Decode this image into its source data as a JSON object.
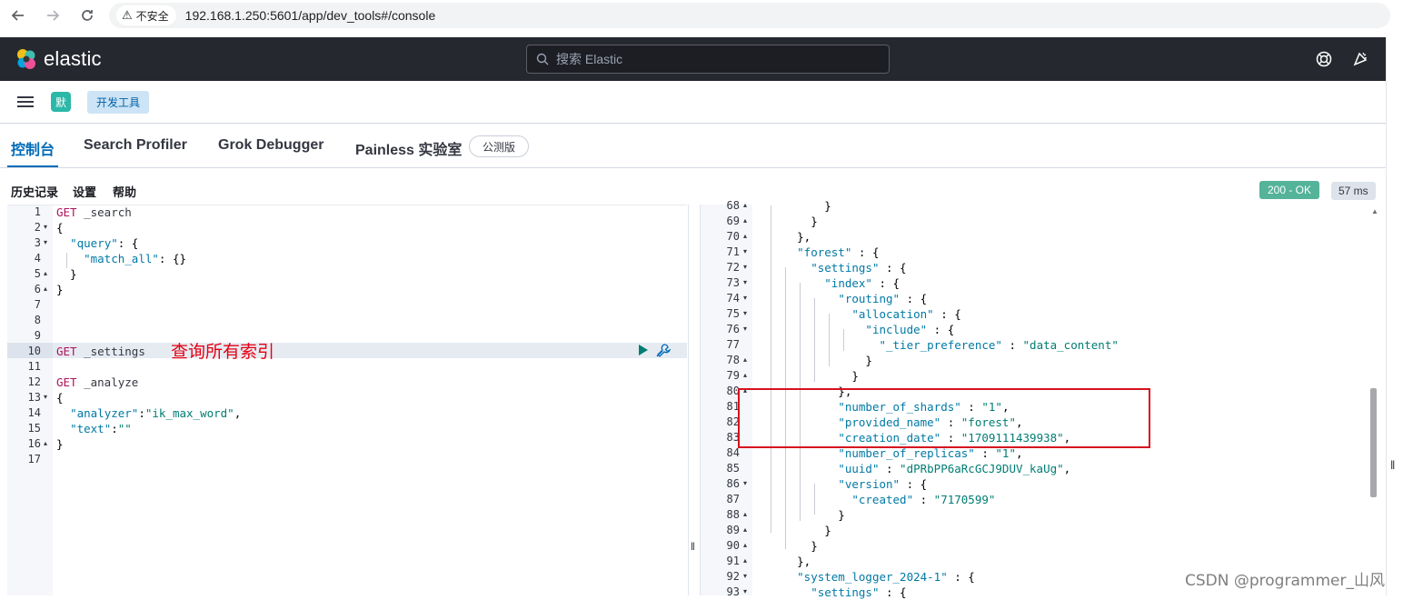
{
  "browser": {
    "insecure_label": "不安全",
    "url": "192.168.1.250:5601/app/dev_tools#/console"
  },
  "header": {
    "logo_text": "elastic",
    "search_placeholder": "搜索 Elastic"
  },
  "breadcrumbs": {
    "space_initial": "默",
    "current": "开发工具"
  },
  "tabs": {
    "console": "控制台",
    "search_profiler": "Search Profiler",
    "grok_debugger": "Grok Debugger",
    "painless_lab": "Painless 实验室",
    "beta_badge": "公测版"
  },
  "toolbar": {
    "history": "历史记录",
    "settings": "设置",
    "help": "帮助",
    "status": "200 - OK",
    "time": "57 ms"
  },
  "annotation": "查询所有索引",
  "request_lines": [
    {
      "n": "1",
      "fold": "",
      "text": "GET _search"
    },
    {
      "n": "2",
      "fold": "▾",
      "text": "{"
    },
    {
      "n": "3",
      "fold": "▾",
      "text": "  \"query\": {"
    },
    {
      "n": "4",
      "fold": "",
      "text": "    \"match_all\": {}"
    },
    {
      "n": "5",
      "fold": "▴",
      "text": "  }"
    },
    {
      "n": "6",
      "fold": "▴",
      "text": "}"
    },
    {
      "n": "7",
      "fold": "",
      "text": ""
    },
    {
      "n": "8",
      "fold": "",
      "text": ""
    },
    {
      "n": "9",
      "fold": "",
      "text": ""
    },
    {
      "n": "10",
      "fold": "",
      "text": "GET _settings"
    },
    {
      "n": "11",
      "fold": "",
      "text": ""
    },
    {
      "n": "12",
      "fold": "",
      "text": "GET _analyze"
    },
    {
      "n": "13",
      "fold": "▾",
      "text": "{"
    },
    {
      "n": "14",
      "fold": "",
      "text": "  \"analyzer\":\"ik_max_word\","
    },
    {
      "n": "15",
      "fold": "",
      "text": "  \"text\":\"\""
    },
    {
      "n": "16",
      "fold": "▴",
      "text": "}"
    },
    {
      "n": "17",
      "fold": "",
      "text": ""
    }
  ],
  "response_lines": [
    {
      "n": "68",
      "fold": "▴",
      "text": "          }"
    },
    {
      "n": "69",
      "fold": "▴",
      "text": "        }"
    },
    {
      "n": "70",
      "fold": "▴",
      "text": "      },"
    },
    {
      "n": "71",
      "fold": "▾",
      "text": "      \"forest\" : {"
    },
    {
      "n": "72",
      "fold": "▾",
      "text": "        \"settings\" : {"
    },
    {
      "n": "73",
      "fold": "▾",
      "text": "          \"index\" : {"
    },
    {
      "n": "74",
      "fold": "▾",
      "text": "            \"routing\" : {"
    },
    {
      "n": "75",
      "fold": "▾",
      "text": "              \"allocation\" : {"
    },
    {
      "n": "76",
      "fold": "▾",
      "text": "                \"include\" : {"
    },
    {
      "n": "77",
      "fold": "",
      "text": "                  \"_tier_preference\" : \"data_content\""
    },
    {
      "n": "78",
      "fold": "▴",
      "text": "                }"
    },
    {
      "n": "79",
      "fold": "▴",
      "text": "              }"
    },
    {
      "n": "80",
      "fold": "▴",
      "text": "            },"
    },
    {
      "n": "81",
      "fold": "",
      "text": "            \"number_of_shards\" : \"1\","
    },
    {
      "n": "82",
      "fold": "",
      "text": "            \"provided_name\" : \"forest\","
    },
    {
      "n": "83",
      "fold": "",
      "text": "            \"creation_date\" : \"1709111439938\","
    },
    {
      "n": "84",
      "fold": "",
      "text": "            \"number_of_replicas\" : \"1\","
    },
    {
      "n": "85",
      "fold": "",
      "text": "            \"uuid\" : \"dPRbPP6aRcGCJ9DUV_kaUg\","
    },
    {
      "n": "86",
      "fold": "▾",
      "text": "            \"version\" : {"
    },
    {
      "n": "87",
      "fold": "",
      "text": "              \"created\" : \"7170599\""
    },
    {
      "n": "88",
      "fold": "▴",
      "text": "            }"
    },
    {
      "n": "89",
      "fold": "▴",
      "text": "          }"
    },
    {
      "n": "90",
      "fold": "▴",
      "text": "        }"
    },
    {
      "n": "91",
      "fold": "▴",
      "text": "      },"
    },
    {
      "n": "92",
      "fold": "▾",
      "text": "      \"system_logger_2024-1\" : {"
    },
    {
      "n": "93",
      "fold": "▾",
      "text": "        \"settings\" : {"
    }
  ],
  "watermark": "CSDN @programmer_山风",
  "colors": {
    "header_bg": "#25282f",
    "accent": "#006bb8",
    "status_ok": "#54b399",
    "annotation": "#e60012"
  }
}
